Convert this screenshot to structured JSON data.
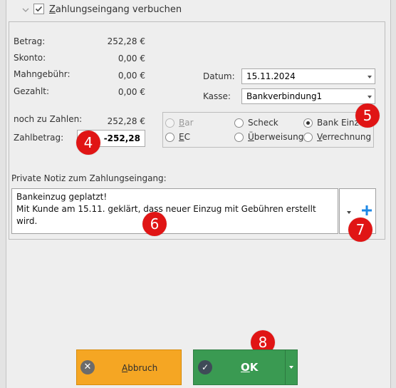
{
  "header": {
    "title": "Zahlungseingang verbuchen",
    "checked": true
  },
  "amounts": {
    "betrag_label": "Betrag:",
    "betrag_value": "252,28 €",
    "skonto_label": "Skonto:",
    "skonto_value": "0,00 €",
    "mahngebuehr_label": "Mahngebühr:",
    "mahngebuehr_value": "0,00 €",
    "gezahlt_label": "Gezahlt:",
    "gezahlt_value": "0,00 €",
    "noch_zu_zahlen_label": "noch zu Zahlen:",
    "noch_zu_zahlen_value": "252,28 €",
    "zahlbetrag_label": "Zahlbetrag:",
    "zahlbetrag_value": "-252,28"
  },
  "datum": {
    "label": "Datum:",
    "value": "15.11.2024"
  },
  "kasse": {
    "label": "Kasse:",
    "value": "Bankverbindung1"
  },
  "payment_methods": [
    {
      "label": "Bar",
      "selected": false,
      "disabled": true
    },
    {
      "label": "Scheck",
      "selected": false,
      "disabled": false
    },
    {
      "label": "Bank Einzu",
      "selected": true,
      "disabled": false
    },
    {
      "label": "EC",
      "selected": false,
      "disabled": false
    },
    {
      "label": "Überweisung",
      "selected": false,
      "disabled": false
    },
    {
      "label": "Verrechnung",
      "selected": false,
      "disabled": false
    }
  ],
  "notiz": {
    "label": "Private Notiz zum Zahlungseingang:",
    "line1": "Bankeinzug geplatzt!",
    "line2": "Mit Kunde am 15.11. geklärt, dass neuer Einzug mit Gebühren erstellt wird."
  },
  "badges": {
    "b4": "4",
    "b5": "5",
    "b6": "6",
    "b7": "7",
    "b8": "8"
  },
  "buttons": {
    "cancel_label": "Abbruch",
    "ok_label": "OK"
  },
  "colors": {
    "cancel": "#f5a623",
    "ok": "#3a9a52",
    "badge": "#e01515",
    "accent_plus": "#1e88e5"
  },
  "icons": {
    "cancel": "close-circle-icon",
    "ok": "check-circle-icon",
    "add": "plus-icon"
  }
}
